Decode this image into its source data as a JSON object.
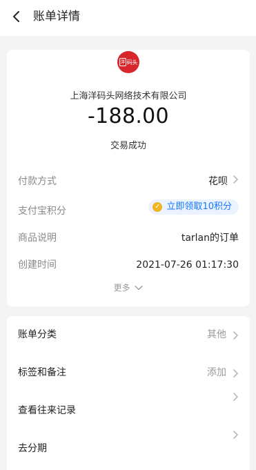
{
  "nav": {
    "title": "账单详情"
  },
  "merchant": {
    "logo_text": "码头",
    "logo_mark": "洋",
    "name": "上海洋码头网络技术有限公司",
    "amount": "-188.00",
    "status": "交易成功"
  },
  "details": {
    "rows": [
      {
        "label": "付款方式",
        "value": "花呗"
      },
      {
        "label": "支付宝积分",
        "value": "立即领取10积分"
      },
      {
        "label": "商品说明",
        "value": "tarlan的订单"
      },
      {
        "label": "创建时间",
        "value": "2021-07-26 01:17:30"
      }
    ],
    "more": "更多"
  },
  "actions": [
    {
      "label": "账单分类",
      "value": "其他"
    },
    {
      "label": "标签和备注",
      "value": "添加"
    },
    {
      "label": "查看往来记录",
      "value": ""
    },
    {
      "label": "去分期",
      "value": ""
    }
  ],
  "icons": {
    "back": "back-chevron-icon",
    "chevron": "chevron-right-icon",
    "points": "points-coin-icon",
    "more": "chevron-down-icon"
  },
  "colors": {
    "accent_blue": "#1677ff",
    "brand_red": "#d8262c",
    "points_bg": "#eaf3ff",
    "coin": "#f2b51f"
  }
}
